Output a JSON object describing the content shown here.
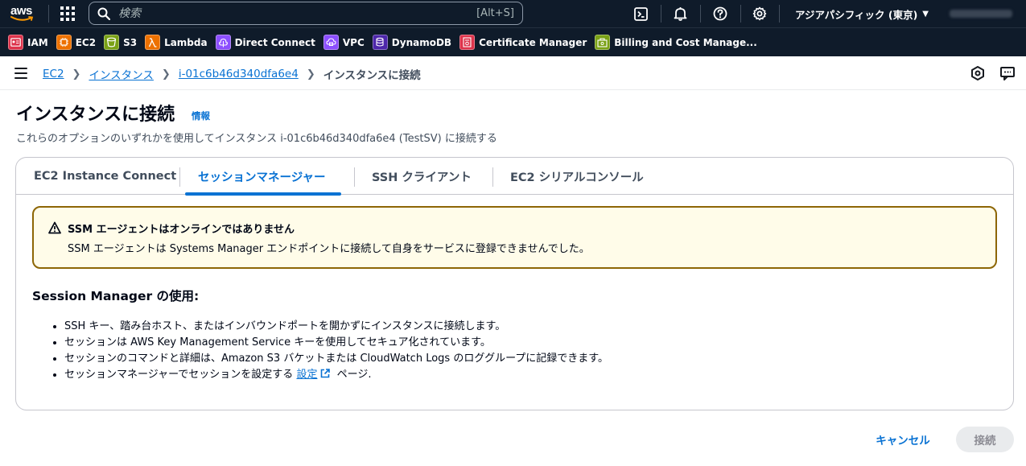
{
  "topnav": {
    "logo_text": "aws",
    "search": {
      "placeholder": "検索",
      "shortcut": "[Alt+S]"
    },
    "region": "アジアパシフィック (東京)",
    "icons": [
      "cloudshell-icon",
      "bell-icon",
      "help-icon",
      "gear-icon"
    ]
  },
  "favorites": [
    {
      "label": "IAM",
      "icon": "iam-icon",
      "color": "#dd344c"
    },
    {
      "label": "EC2",
      "icon": "ec2-icon",
      "color": "#ed7100"
    },
    {
      "label": "S3",
      "icon": "s3-icon",
      "color": "#7aa116"
    },
    {
      "label": "Lambda",
      "icon": "lambda-icon",
      "color": "#ed7100"
    },
    {
      "label": "Direct Connect",
      "icon": "direct-connect-icon",
      "color": "#8c4fff"
    },
    {
      "label": "VPC",
      "icon": "vpc-icon",
      "color": "#8c4fff"
    },
    {
      "label": "DynamoDB",
      "icon": "dynamodb-icon",
      "color": "#4d27aa"
    },
    {
      "label": "Certificate Manager",
      "icon": "certificate-manager-icon",
      "color": "#dd344c"
    },
    {
      "label": "Billing and Cost Manage...",
      "icon": "billing-icon",
      "color": "#7aa116"
    }
  ],
  "breadcrumb": {
    "items": [
      "EC2",
      "インスタンス",
      "i-01c6b46d340dfa6e4"
    ],
    "current": "インスタンスに接続"
  },
  "page": {
    "title": "インスタンスに接続",
    "info": "情報",
    "description": "これらのオプションのいずれかを使用してインスタンス i-01c6b46d340dfa6e4 (TestSV) に接続する"
  },
  "tabs": [
    {
      "label": "EC2 Instance Connect",
      "active": false
    },
    {
      "label": "セッションマネージャー",
      "active": true
    },
    {
      "label": "SSH クライアント",
      "active": false
    },
    {
      "label": "EC2 シリアルコンソール",
      "active": false
    }
  ],
  "alert": {
    "title": "SSM エージェントはオンラインではありません",
    "body": "SSM エージェントは Systems Manager エンドポイントに接続して自身をサービスに登録できませんでした。"
  },
  "session_manager": {
    "heading": "Session Manager の使用:",
    "bullets": [
      "SSH キー、踏み台ホスト、またはインバウンドポートを開かずにインスタンスに接続します。",
      "セッションは AWS Key Management Service キーを使用してセキュア化されています。",
      "セッションのコマンドと詳細は、Amazon S3 バケットまたは CloudWatch Logs のロググループに記録できます。"
    ],
    "last_bullet": {
      "prefix": "セッションマネージャーでセッションを設定する ",
      "link": "設定",
      "suffix": " ページ."
    }
  },
  "footer": {
    "cancel": "キャンセル",
    "connect": "接続"
  },
  "colors": {
    "link": "#0972d3",
    "nav_bg": "#0f1b2a",
    "warning_border": "#8d6605",
    "warning_bg": "#fffce9"
  }
}
